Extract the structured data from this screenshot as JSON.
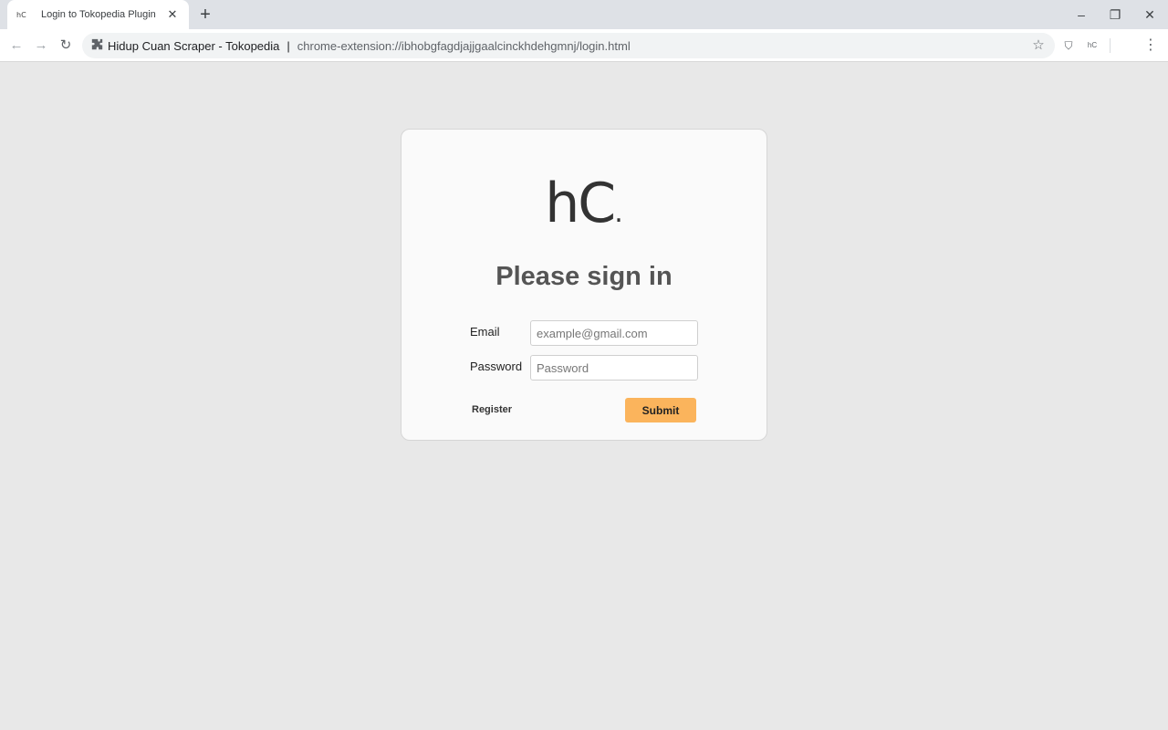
{
  "browser": {
    "tab": {
      "favicon": "hC",
      "title": "Login to Tokopedia Plugin",
      "close": "✕"
    },
    "new_tab": "+",
    "window_controls": {
      "minimize": "–",
      "restore": "❐",
      "close": "✕"
    },
    "nav": {
      "back": "←",
      "forward": "→",
      "reload": "↻"
    },
    "omnibox": {
      "icon": "puzzle-icon",
      "site_name": "Hidup Cuan Scraper - Tokopedia",
      "separator": "|",
      "url": "chrome-extension://ibhobgfagdjajjgaalcinckhdehgmnj/login.html"
    },
    "toolbar_icons": {
      "bookmark": "☆",
      "shield": "⛉",
      "extension": "hC",
      "menu": "⋮"
    }
  },
  "login": {
    "logo": "hC",
    "logo_dot": ".",
    "heading": "Please sign in",
    "email_label": "Email",
    "email_placeholder": "example@gmail.com",
    "password_label": "Password",
    "password_placeholder": "Password",
    "register_label": "Register",
    "submit_label": "Submit"
  },
  "colors": {
    "page_bg": "#e8e8e8",
    "submit_bg": "#fbb45c",
    "heading": "#555555"
  }
}
